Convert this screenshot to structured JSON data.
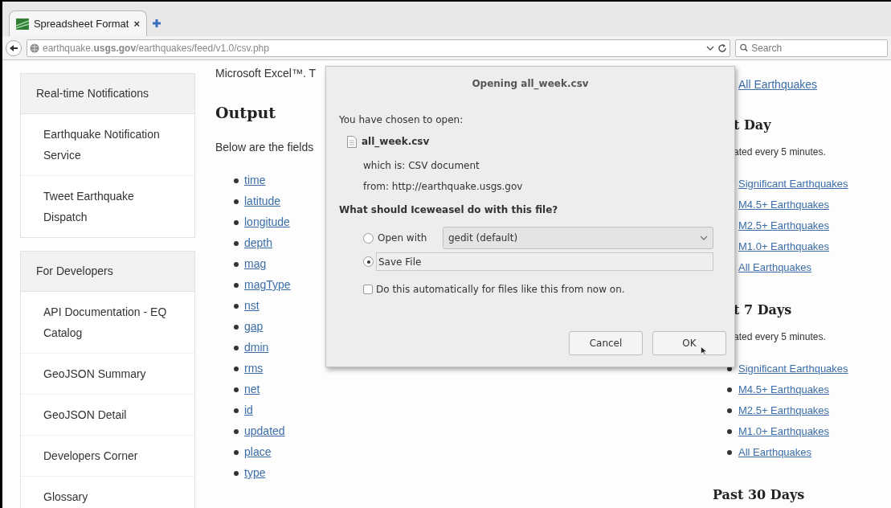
{
  "browser": {
    "tabs": [
      {
        "title": "Spreadsheet Format",
        "close": "×",
        "selected": true
      }
    ],
    "url": "earthquake.**usgs.gov**/earthquakes/feed/v1.0/csv.php",
    "search": {
      "placeholder": "Search"
    }
  },
  "sidebar": {
    "panels": [
      {
        "heading": "Real-time Notifications",
        "items": [
          "Earthquake Notification Service",
          "Tweet Earthquake Dispatch"
        ]
      },
      {
        "heading": "For Developers",
        "items": [
          "API Documentation - EQ Catalog",
          "GeoJSON Summary",
          "GeoJSON Detail",
          "Developers Corner",
          "Glossary"
        ]
      }
    ]
  },
  "main": {
    "intro": "Microsoft Excel™. T",
    "heading": "Output",
    "lead": "Below are the fields",
    "fields": [
      "time",
      "latitude",
      "longitude",
      "depth",
      "mag",
      "magType",
      "nst",
      "gap",
      "dmin",
      "rms",
      "net",
      "id",
      "updated",
      "place",
      "type"
    ]
  },
  "right_column": {
    "top_link": "All Earthquakes",
    "sections": [
      {
        "kind": "covered",
        "heading": "t Day",
        "note": "ated every 5 minutes.",
        "links": [
          "Significant Earthquakes",
          "M4.5+ Earthquakes",
          "M2.5+ Earthquakes",
          "M1.0+ Earthquakes",
          "All Earthquakes"
        ]
      },
      {
        "kind": "half_covered",
        "heading": "t 7 Days",
        "note": "ated every 5 minutes.",
        "links": [
          "Significant Earthquakes",
          "M4.5+ Earthquakes",
          "M2.5+ Earthquakes",
          "M1.0+ Earthquakes",
          "All Earthquakes"
        ]
      },
      {
        "kind": "plain",
        "heading": "Past 30 Days"
      }
    ]
  },
  "dialog": {
    "title": "Opening all_week.csv",
    "chosen": "You have chosen to open:",
    "file_name": "all_week.csv",
    "type_line": "which is: CSV document",
    "from_line": "from: http://earthquake.usgs.gov",
    "question": "What should Iceweasel do with this file?",
    "options": [
      {
        "kind": "open_with",
        "label": "Open with",
        "app": "gedit (default)",
        "selected": false
      },
      {
        "kind": "save",
        "label": "Save File",
        "selected": true
      }
    ],
    "auto": {
      "label": "Do this automatically for files like this from now on.",
      "checked": false
    },
    "buttons": [
      "Cancel",
      "OK"
    ]
  }
}
